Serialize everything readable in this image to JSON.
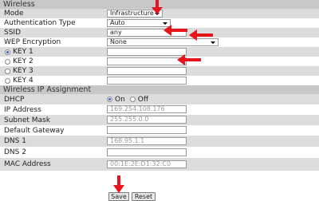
{
  "sections": {
    "wireless": "Wireless",
    "ip_assignment": "Wireless IP Assignment"
  },
  "wireless": {
    "mode": {
      "label": "Mode",
      "value": "Infrastructure"
    },
    "auth": {
      "label": "Authentication Type",
      "value": "Auto"
    },
    "ssid": {
      "label": "SSID",
      "value": "any"
    },
    "wep": {
      "label": "WEP Encryption",
      "value": "None"
    },
    "keys": [
      {
        "label": "KEY 1",
        "selected": true,
        "value": ""
      },
      {
        "label": "KEY 2",
        "selected": false,
        "value": ""
      },
      {
        "label": "KEY 3",
        "selected": false,
        "value": ""
      },
      {
        "label": "KEY 4",
        "selected": false,
        "value": ""
      }
    ]
  },
  "ip": {
    "dhcp": {
      "label": "DHCP",
      "on_label": "On",
      "off_label": "Off",
      "selected": "On"
    },
    "ip_address": {
      "label": "IP Address",
      "value": "169.254.108.176"
    },
    "subnet": {
      "label": "Subnet Mask",
      "value": "255.255.0.0"
    },
    "gateway": {
      "label": "Default Gateway",
      "value": ""
    },
    "dns1": {
      "label": "DNS 1",
      "value": "168.95.1.1"
    },
    "dns2": {
      "label": "DNS 2",
      "value": ""
    },
    "mac": {
      "label": "MAC Address",
      "value": "00:1E:2E:D1:32:C0"
    }
  },
  "buttons": {
    "save": "Save",
    "reset": "Reset"
  },
  "colors": {
    "annotation_arrow": "#e8141c",
    "section_bg": "#c7c7c7",
    "row_shade": "#dcdcdc"
  }
}
